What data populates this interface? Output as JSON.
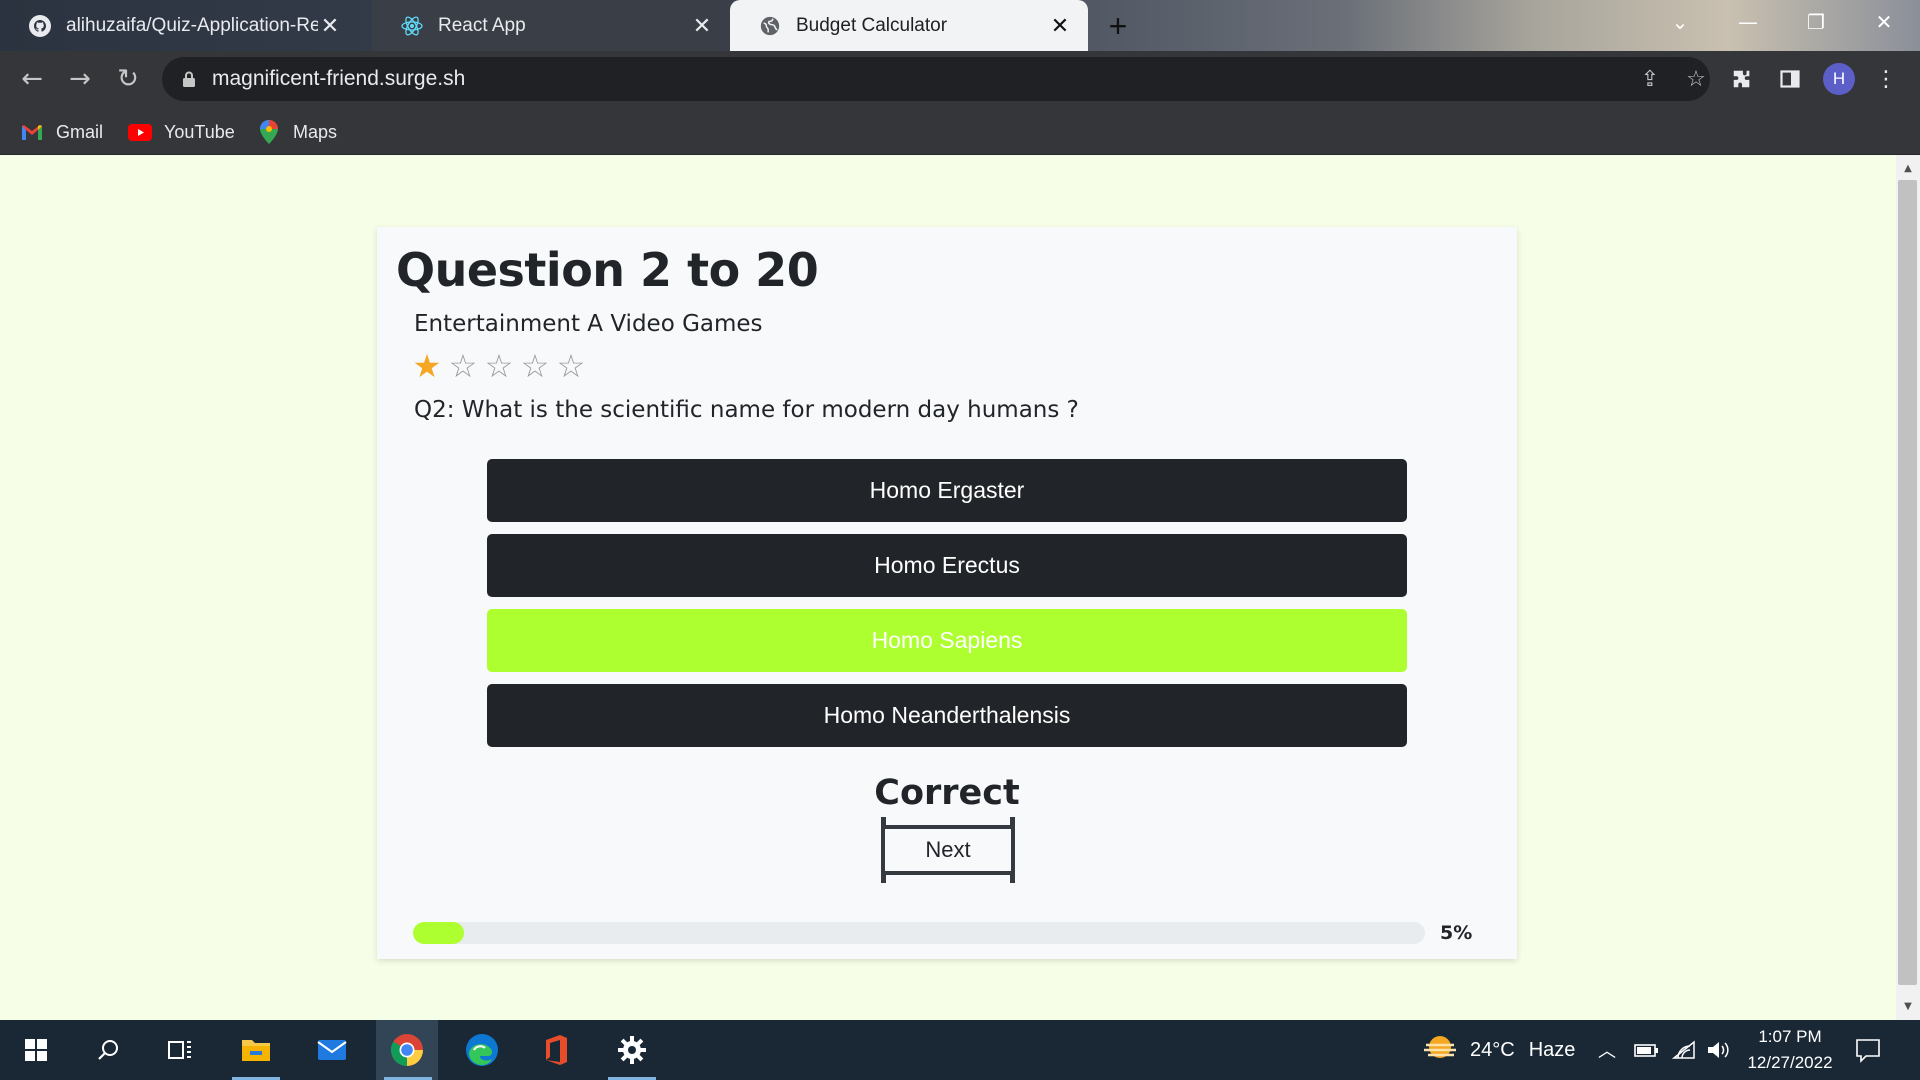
{
  "browser": {
    "tabs": [
      {
        "title": "alihuzaifa/Quiz-Application-React",
        "icon": "github-icon"
      },
      {
        "title": "React App",
        "icon": "react-icon"
      },
      {
        "title": "Budget Calculator",
        "icon": "globe-icon"
      }
    ],
    "active_tab_index": 2,
    "url": "magnificent-friend.surge.sh",
    "profile_initial": "H",
    "bookmarks": [
      {
        "label": "Gmail",
        "icon": "gmail-icon"
      },
      {
        "label": "YouTube",
        "icon": "youtube-icon"
      },
      {
        "label": "Maps",
        "icon": "maps-icon"
      }
    ]
  },
  "quiz": {
    "header": "Question 2 to 20",
    "category": "Entertainment A Video Games",
    "difficulty_stars": 1,
    "difficulty_max": 5,
    "question": "Q2: What is the scientific name for modern day humans ?",
    "options": [
      {
        "label": "Homo Ergaster",
        "state": "default"
      },
      {
        "label": "Homo Erectus",
        "state": "default"
      },
      {
        "label": "Homo Sapiens",
        "state": "correct"
      },
      {
        "label": "Homo Neanderthalensis",
        "state": "default"
      }
    ],
    "result": "Correct",
    "next_label": "Next",
    "progress_percent": 5,
    "progress_label": "5%"
  },
  "colors": {
    "page_bg": "#f6fee8",
    "option_bg": "#212529",
    "correct_bg": "#adff2f",
    "progress_fill": "#adff2f"
  },
  "taskbar": {
    "weather_temp": "24°C",
    "weather_desc": "Haze",
    "time": "1:07 PM",
    "date": "12/27/2022"
  }
}
